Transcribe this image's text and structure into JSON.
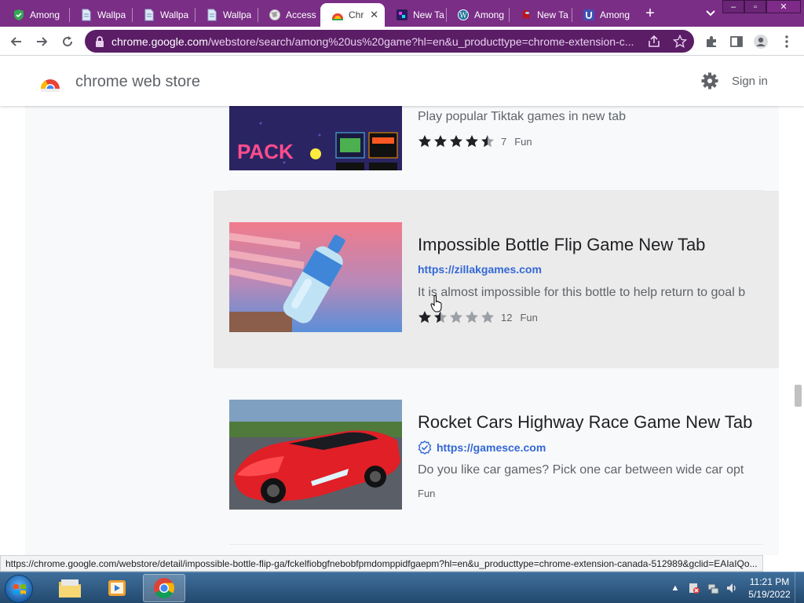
{
  "tabs": [
    {
      "title": "Among",
      "icon": "shield-icon"
    },
    {
      "title": "Wallpa",
      "icon": "document-icon"
    },
    {
      "title": "Wallpa",
      "icon": "document-icon"
    },
    {
      "title": "Wallpa",
      "icon": "document-icon"
    },
    {
      "title": "Access",
      "icon": "globe-icon"
    },
    {
      "title": "Chr",
      "icon": "chrome-web-store-icon",
      "active": true
    },
    {
      "title": "New Ta",
      "icon": "app-icon"
    },
    {
      "title": "Among",
      "icon": "wordpress-icon"
    },
    {
      "title": "New Ta",
      "icon": "among-us-icon"
    },
    {
      "title": "Among",
      "icon": "u-icon"
    }
  ],
  "window": {
    "minimize": "–",
    "maximize": "▫",
    "close": "✕"
  },
  "address": {
    "host": "chrome.google.com",
    "path": "/webstore/search/among%20us%20game?hl=en&u_producttype=chrome-extension-c..."
  },
  "store": {
    "name": "chrome web store",
    "signin": "Sign in"
  },
  "results": [
    {
      "title": "",
      "url": "",
      "description": "Play popular Tiktak games in new tab",
      "stars": 4.5,
      "rating_count": "7",
      "category": "Fun",
      "thumb_text": "PACK"
    },
    {
      "title": "Impossible Bottle Flip Game New Tab",
      "url": "https://zillakgames.com",
      "description": "It is almost impossible for this bottle to help return to goal b",
      "stars": 1.5,
      "rating_count": "12",
      "category": "Fun",
      "verified": false
    },
    {
      "title": "Rocket Cars Highway Race Game New Tab",
      "url": "https://gamesce.com",
      "description": "Do you like car games? Pick one car between wide car opt",
      "category": "Fun",
      "verified": true
    }
  ],
  "status_url": "https://chrome.google.com/webstore/detail/impossible-bottle-flip-ga/fckelfiobgfnebobfpmdomppidfgaepm?hl=en&u_producttype=chrome-extension-canada-512989&gclid=EAIaIQo...",
  "clock": {
    "time": "11:21 PM",
    "date": "5/19/2022"
  },
  "colors": {
    "frame": "#7a2e86",
    "omnibox": "#5a1d66",
    "link": "#3367d6"
  }
}
